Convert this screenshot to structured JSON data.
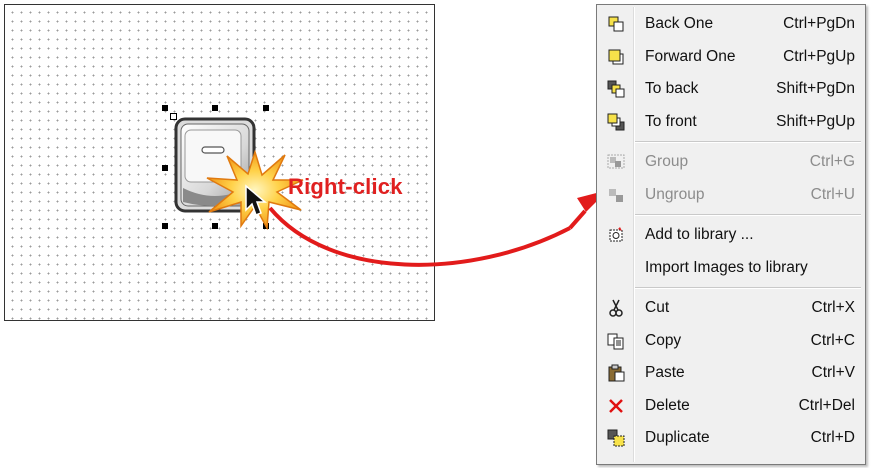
{
  "annotation": {
    "text": "Right-click"
  },
  "menu": {
    "groups": [
      [
        {
          "label": "Back One",
          "shortcut": "Ctrl+PgDn",
          "icon": "back-one-icon",
          "enabled": true
        },
        {
          "label": "Forward One",
          "shortcut": "Ctrl+PgUp",
          "icon": "forward-one-icon",
          "enabled": true
        },
        {
          "label": "To back",
          "shortcut": "Shift+PgDn",
          "icon": "to-back-icon",
          "enabled": true
        },
        {
          "label": "To front",
          "shortcut": "Shift+PgUp",
          "icon": "to-front-icon",
          "enabled": true
        }
      ],
      [
        {
          "label": "Group",
          "shortcut": "Ctrl+G",
          "icon": "group-icon",
          "enabled": false
        },
        {
          "label": "Ungroup",
          "shortcut": "Ctrl+U",
          "icon": "ungroup-icon",
          "enabled": false
        }
      ],
      [
        {
          "label": "Add to library ...",
          "shortcut": "",
          "icon": "add-to-library-icon",
          "enabled": true
        },
        {
          "label": "Import Images to library",
          "shortcut": "",
          "icon": "",
          "enabled": true
        }
      ],
      [
        {
          "label": "Cut",
          "shortcut": "Ctrl+X",
          "icon": "scissors-icon",
          "enabled": true
        },
        {
          "label": "Copy",
          "shortcut": "Ctrl+C",
          "icon": "copy-icon",
          "enabled": true
        },
        {
          "label": "Paste",
          "shortcut": "Ctrl+V",
          "icon": "paste-icon",
          "enabled": true
        },
        {
          "label": "Delete",
          "shortcut": "Ctrl+Del",
          "icon": "delete-icon",
          "enabled": true
        },
        {
          "label": "Duplicate",
          "shortcut": "Ctrl+D",
          "icon": "duplicate-icon",
          "enabled": true
        }
      ]
    ]
  },
  "colors": {
    "annotation": "#e02020",
    "arrow": "#e21b1b",
    "menu_bg": "#f0f0f0",
    "disabled_text": "#8c8c8c",
    "icon_yellow": "#f7e24a"
  }
}
